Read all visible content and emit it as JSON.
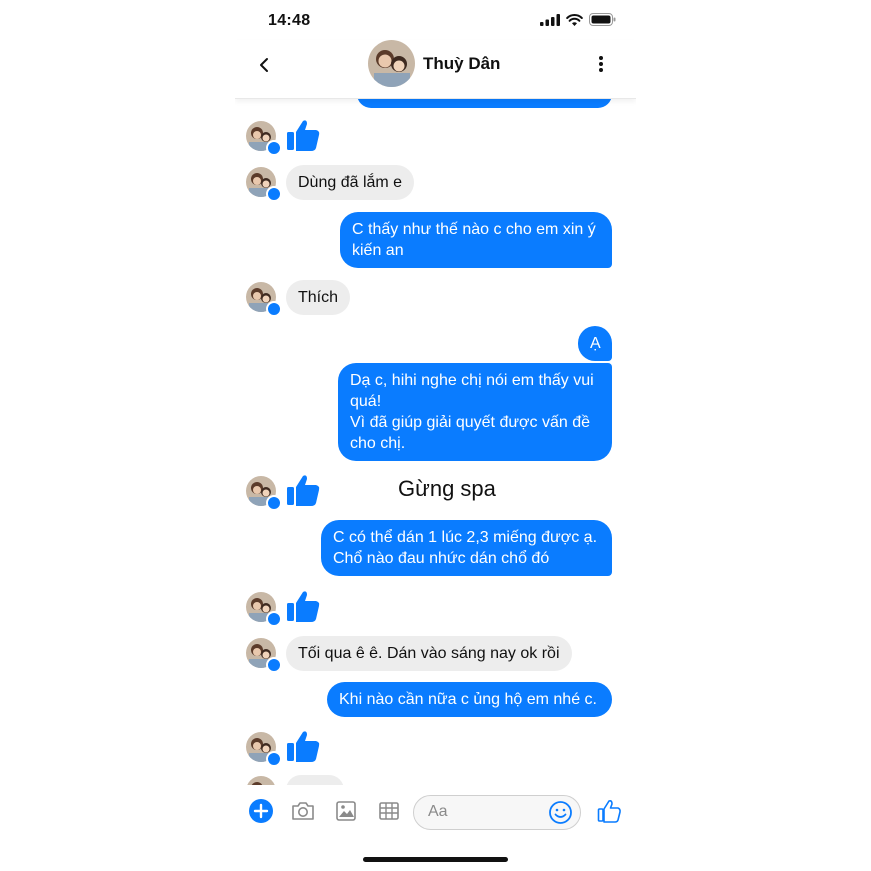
{
  "status": {
    "time": "14:48"
  },
  "header": {
    "contact_name": "Thuỳ Dân"
  },
  "watermark": "Gừng spa",
  "messages": [
    {
      "sender": "them",
      "type": "like"
    },
    {
      "sender": "them",
      "type": "text",
      "text": "Dùng đã lắm e"
    },
    {
      "sender": "me",
      "type": "text",
      "lines": [
        "C thấy như thế nào c cho em xin ý",
        "kiến an"
      ]
    },
    {
      "sender": "them",
      "type": "text",
      "text": "Thích"
    },
    {
      "sender": "me",
      "type": "text",
      "text": "Ạ"
    },
    {
      "sender": "me",
      "type": "text",
      "lines": [
        "Dạ c, hihi nghe chị nói em thấy vui",
        "quá!",
        "Vì đã giúp giải quyết được vấn đề",
        "cho chị."
      ]
    },
    {
      "sender": "them",
      "type": "like"
    },
    {
      "sender": "me",
      "type": "text",
      "lines": [
        "C có thể dán 1 lúc 2,3 miếng được ạ.",
        "Chổ nào đau nhức dán chổ đó"
      ]
    },
    {
      "sender": "them",
      "type": "like"
    },
    {
      "sender": "them",
      "type": "text",
      "text": "Tối qua ê ê. Dán vào sáng nay ok rồi"
    },
    {
      "sender": "me",
      "type": "text",
      "text": "Khi nào cần nữa c ủng hộ em nhé c."
    },
    {
      "sender": "them",
      "type": "like"
    }
  ],
  "composer": {
    "placeholder": "Aa"
  },
  "colors": {
    "accent": "#0a7cff",
    "incoming_bubble": "#ededed"
  },
  "icons": [
    "back-chevron-icon",
    "more-vertical-icon",
    "plus-icon",
    "camera-icon",
    "gallery-icon",
    "sticker-grid-icon",
    "emoji-icon",
    "thumbs-up-icon",
    "messenger-badge-icon",
    "signal-icon",
    "wifi-icon",
    "battery-icon"
  ]
}
